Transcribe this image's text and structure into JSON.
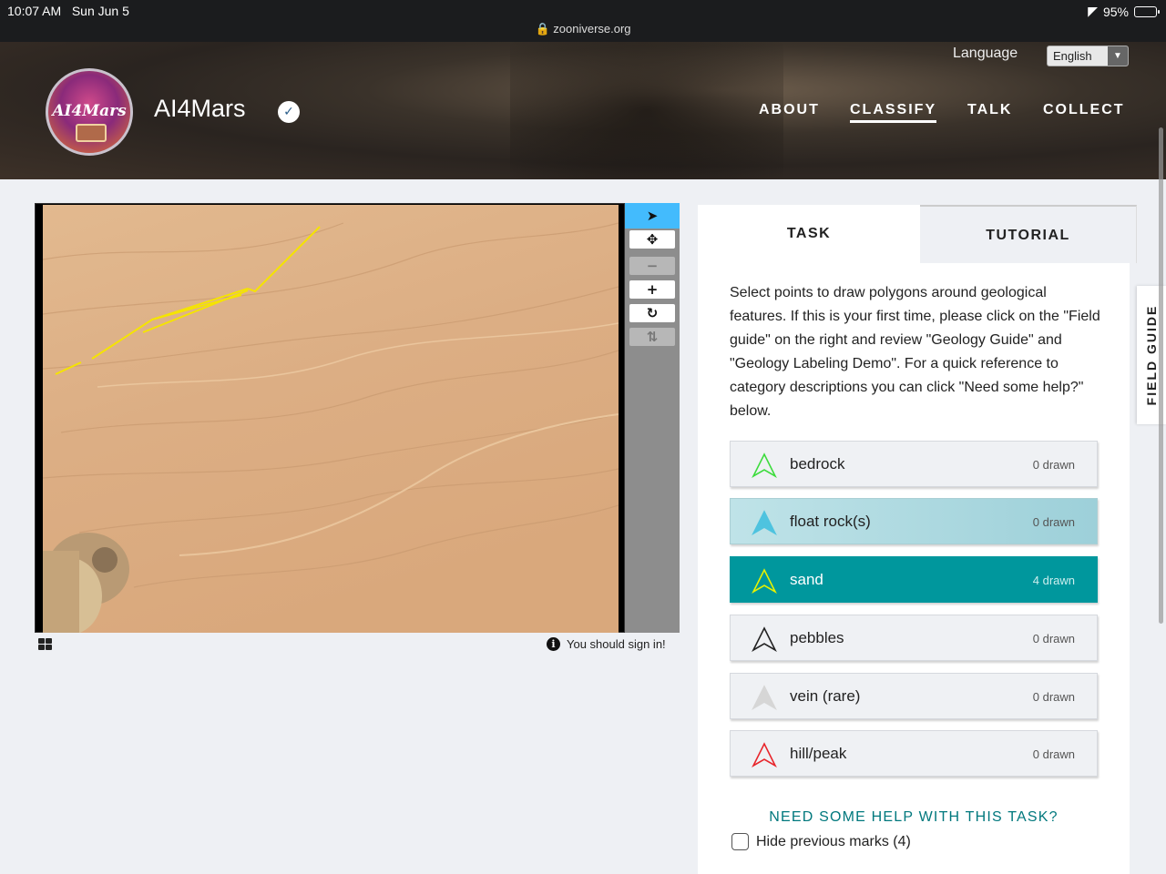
{
  "status_bar": {
    "time": "10:07 AM",
    "date": "Sun Jun 5",
    "url": "zooniverse.org",
    "battery": "95%",
    "battery_level": 0.95
  },
  "header": {
    "project_title": "AI4Mars",
    "logo_text": "AI4Mars",
    "language_label": "Language",
    "language_value": "English",
    "nav": [
      {
        "label": "ABOUT",
        "active": false
      },
      {
        "label": "CLASSIFY",
        "active": true
      },
      {
        "label": "TALK",
        "active": false
      },
      {
        "label": "COLLECT",
        "active": false
      }
    ]
  },
  "viewer": {
    "toolbar": [
      {
        "name": "pointer-tool",
        "icon": "arrow-pointer-icon"
      },
      {
        "name": "pan-tool",
        "icon": "move-icon"
      },
      {
        "name": "zoom-out",
        "icon": "minus-icon"
      },
      {
        "name": "zoom-in",
        "icon": "plus-icon"
      },
      {
        "name": "rotate",
        "icon": "rotate-icon"
      },
      {
        "name": "reset",
        "icon": "refresh-icon"
      }
    ],
    "sign_in_notice": "You should sign in!",
    "mark_color": "#f5e400"
  },
  "task": {
    "tabs": [
      "TASK",
      "TUTORIAL"
    ],
    "instructions": "Select points to draw polygons around geological features. If this is your first time, please click on the \"Field guide\" on the right and review \"Geology Guide\" and \"Geology Labeling Demo\". For a quick reference to category descriptions you can click \"Need some help?\" below.",
    "answers": [
      {
        "label": "bedrock",
        "count": "0 drawn",
        "color": "#3ddc3d"
      },
      {
        "label": "float rock(s)",
        "count": "0 drawn",
        "color": "#4ec3df"
      },
      {
        "label": "sand",
        "count": "4 drawn",
        "color": "#e6f200"
      },
      {
        "label": "pebbles",
        "count": "0 drawn",
        "color": "#222222"
      },
      {
        "label": "vein (rare)",
        "count": "0 drawn",
        "color": "#d6d6d6"
      },
      {
        "label": "hill/peak",
        "count": "0 drawn",
        "color": "#e8252b"
      }
    ],
    "selected_answer": "sand",
    "help_link": "NEED SOME HELP WITH THIS TASK?",
    "hide_marks_label": "Hide previous marks (4)"
  },
  "field_guide_label": "FIELD GUIDE",
  "colors": {
    "accent": "#00979d",
    "active_tool": "#43bbfd"
  }
}
